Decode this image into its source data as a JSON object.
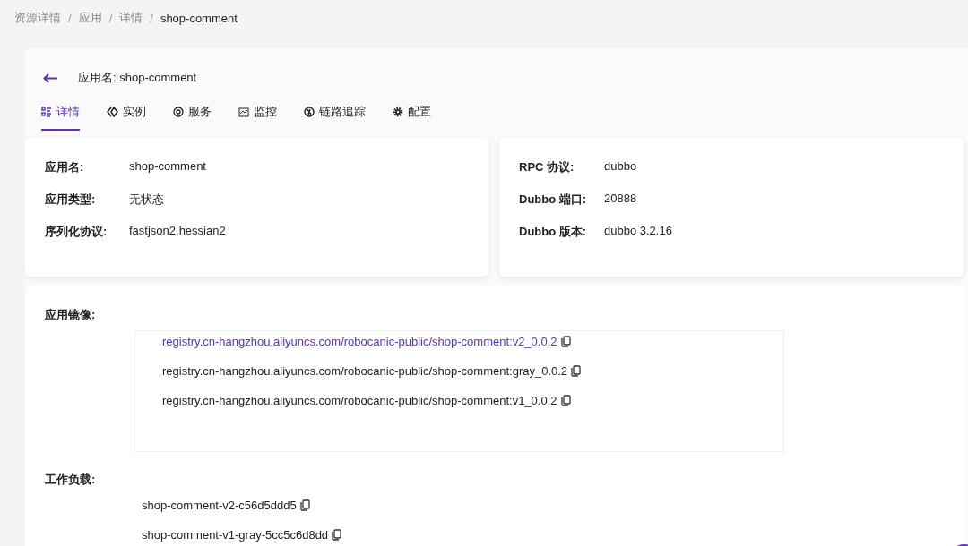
{
  "breadcrumb": [
    {
      "kind": "link",
      "label": "资源详情",
      "current": false
    },
    {
      "kind": "separator",
      "label": "/"
    },
    {
      "kind": "link",
      "label": "应用",
      "current": false
    },
    {
      "kind": "separator",
      "label": "/"
    },
    {
      "kind": "link",
      "label": "详情",
      "current": false
    },
    {
      "kind": "separator",
      "label": "/"
    },
    {
      "kind": "link",
      "label": "shop-comment",
      "current": true
    }
  ],
  "header": {
    "title": "应用名: shop-comment"
  },
  "tabs": [
    {
      "label": "详情",
      "selected": true
    },
    {
      "label": "实例",
      "selected": false
    },
    {
      "label": "服务",
      "selected": false
    },
    {
      "label": "监控",
      "selected": false
    },
    {
      "label": "链路追踪",
      "selected": false
    },
    {
      "label": "配置",
      "selected": false
    }
  ],
  "basic_info": [
    {
      "label": "应用名:",
      "value": "shop-comment"
    },
    {
      "label": "应用类型:",
      "value": "无状态"
    },
    {
      "label": "序列化协议:",
      "value": "fastjson2,hessian2"
    }
  ],
  "rpc_info": [
    {
      "label": "RPC 协议:",
      "value": "dubbo"
    },
    {
      "label": "Dubbo 端口:",
      "value": "20888"
    },
    {
      "label": "Dubbo 版本:",
      "value": "dubbo 3.2.16"
    }
  ],
  "images": {
    "label": "应用镜像:",
    "items": [
      {
        "text": "registry.cn-hangzhou.aliyuncs.com/robocanic-public/shop-comment:v2_0.0.2",
        "selected": true
      },
      {
        "text": "registry.cn-hangzhou.aliyuncs.com/robocanic-public/shop-comment:gray_0.0.2",
        "selected": false
      },
      {
        "text": "registry.cn-hangzhou.aliyuncs.com/robocanic-public/shop-comment:v1_0.0.2",
        "selected": false
      }
    ]
  },
  "workloads": {
    "label": "工作负载:",
    "items": [
      {
        "text": "shop-comment-v2-c56d5ddd5"
      },
      {
        "text": "shop-comment-v1-gray-5cc5c6d8dd"
      }
    ]
  }
}
